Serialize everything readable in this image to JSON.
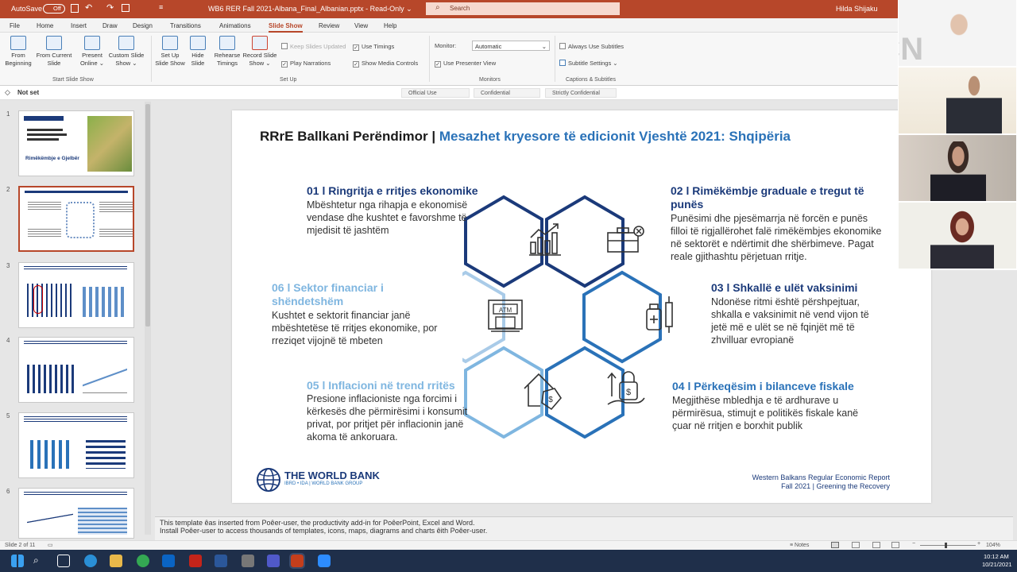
{
  "titlebar": {
    "autosave_label": "AutoSave",
    "autosave_state": "Off",
    "file_title": "WB6 RER Fall 2021-Albana_Final_Albanian.pptx  -  Read-Only  ⌄",
    "search_placeholder": "Search",
    "user_name": "Hilda Shijaku"
  },
  "menu": {
    "tabs": [
      "File",
      "Home",
      "Insert",
      "Draw",
      "Design",
      "Transitions",
      "Animations",
      "Slide Show",
      "Review",
      "View",
      "Help"
    ],
    "active": "Slide Show"
  },
  "ribbon": {
    "from_beginning": "From Beginning",
    "from_current": "From Current Slide",
    "present_online": "Present Online ⌄",
    "custom_slide_show": "Custom Slide Show ⌄",
    "group_start": "Start Slide Show",
    "set_up_slide_show": "Set Up Slide Show",
    "hide_slide": "Hide Slide",
    "rehearse_timings": "Rehearse Timings",
    "record_slide_show": "Record Slide Show ⌄",
    "keep_slides_updated": "Keep Slides Updated",
    "use_timings": "Use Timings",
    "play_narrations": "Play Narrations",
    "show_media_controls": "Show Media Controls",
    "group_setup": "Set Up",
    "monitor_label": "Monitor:",
    "monitor_value": "Automatic",
    "use_presenter_view": "Use Presenter View",
    "group_monitors": "Monitors",
    "always_use_subtitles": "Always Use Subtitles",
    "subtitle_settings": "Subtitle Settings ⌄",
    "group_captions": "Captions & Subtitles"
  },
  "sensitivity": {
    "not_set": "Not set",
    "options": [
      "Official Use",
      "Confidential",
      "Strictly Confidential"
    ]
  },
  "thumbnails": {
    "numbers": [
      "1",
      "2",
      "3",
      "4",
      "5",
      "6"
    ],
    "selected": 2,
    "slide1_title": "Rimëkëmbje e Gjelbër"
  },
  "slide": {
    "title_prefix": "RRrE Ballkani Perëndimor |",
    "title_main": " Mesazhet kryesore të edicionit Vjeshtë 2021: Shqipëria",
    "sections": [
      {
        "title": "01 l Ringritja e rritjes ekonomike",
        "body": "Mbështetur nga rihapja e ekonomisë vendase dhe kushtet e favorshme të mjedisit të jashtëm"
      },
      {
        "title": "02 l Rimëkëmbje graduale e tregut të punës",
        "body": "Punësimi dhe pjesëmarrja në forcën e punës filloi të rigjallërohet falë rimëkëmbjes ekonomike në sektorët e ndërtimit dhe shërbimeve. Pagat reale gjithashtu përjetuan rritje."
      },
      {
        "title": "03 l Shkallë e ulët vaksinimi",
        "body": "Ndonëse ritmi është përshpejtuar, shkalla e vaksinimit në vend vijon të jetë më e ulët se në fqinjët më të zhvilluar evropianë"
      },
      {
        "title": "04 l Përkeqësim i bilanceve fiskale",
        "body": "Megjithëse mbledhja e të ardhurave u përmirësua, stimujt e politikës fiskale kanë çuar në rritjen e borxhit publik"
      },
      {
        "title": "05 l Inflacioni në trend rritës",
        "body": "Presione inflacioniste nga forcimi i kërkesës dhe përmirësimi i konsumit privat, por pritjet për inflacionin janë akoma të ankoruara."
      },
      {
        "title": "06 l Sektor financiar i shëndetshëm",
        "body": "Kushtet e sektorit financiar janë mbështetëse të rritjes ekonomike, por rreziqet vijojnë të mbeten"
      }
    ],
    "atm_label": "ATM",
    "logo_name": "THE WORLD BANK",
    "logo_sub": "IBRD • IDA | WORLD BANK GROUP",
    "footer_line1": "Western Balkans Regular Economic Report",
    "footer_line2": "Fall 2021 | Greening the Recovery",
    "colors": {
      "navy": "#1b3a7a",
      "blue": "#2a72b8",
      "light": "#7fb6e0",
      "pale": "#a9cbe8"
    }
  },
  "notes": {
    "line1": "This template êas inserted from Poêer-user, the productivity add-in for PoêerPoint, Excel and Word.",
    "line2": "Install Poêer-user to access thousands of templates, icons, maps, diagrams and charts êith Poêer-user."
  },
  "status": {
    "slide_count": "Slide 2 of 11",
    "notes_label": "Notes",
    "zoom": "104%"
  },
  "taskbar": {
    "time": "10:12 AM",
    "date": "10/21/2021"
  },
  "watermark": "MCN"
}
